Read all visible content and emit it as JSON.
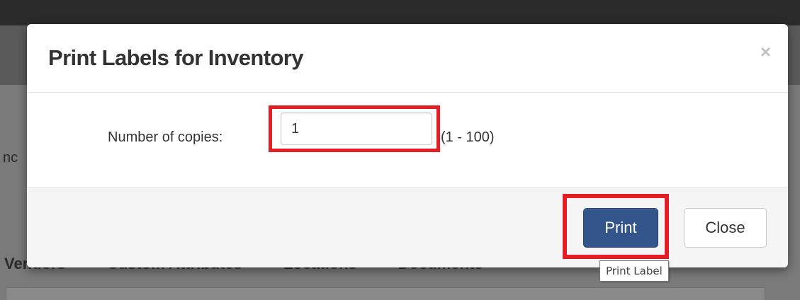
{
  "background": {
    "fragment_text": "nc",
    "tabs": [
      "Vendors",
      "Custom Attributes",
      "Locations",
      "Documents"
    ]
  },
  "modal": {
    "title": "Print Labels for Inventory",
    "close_icon": "×",
    "body": {
      "copies_label": "Number of copies:",
      "copies_value": "1",
      "copies_hint": "(1 - 100)"
    },
    "footer": {
      "print_label": "Print",
      "close_label": "Close"
    }
  },
  "tooltip": {
    "text": "Print Label"
  },
  "colors": {
    "primary_button": "#34558b",
    "highlight": "#e31e24"
  }
}
